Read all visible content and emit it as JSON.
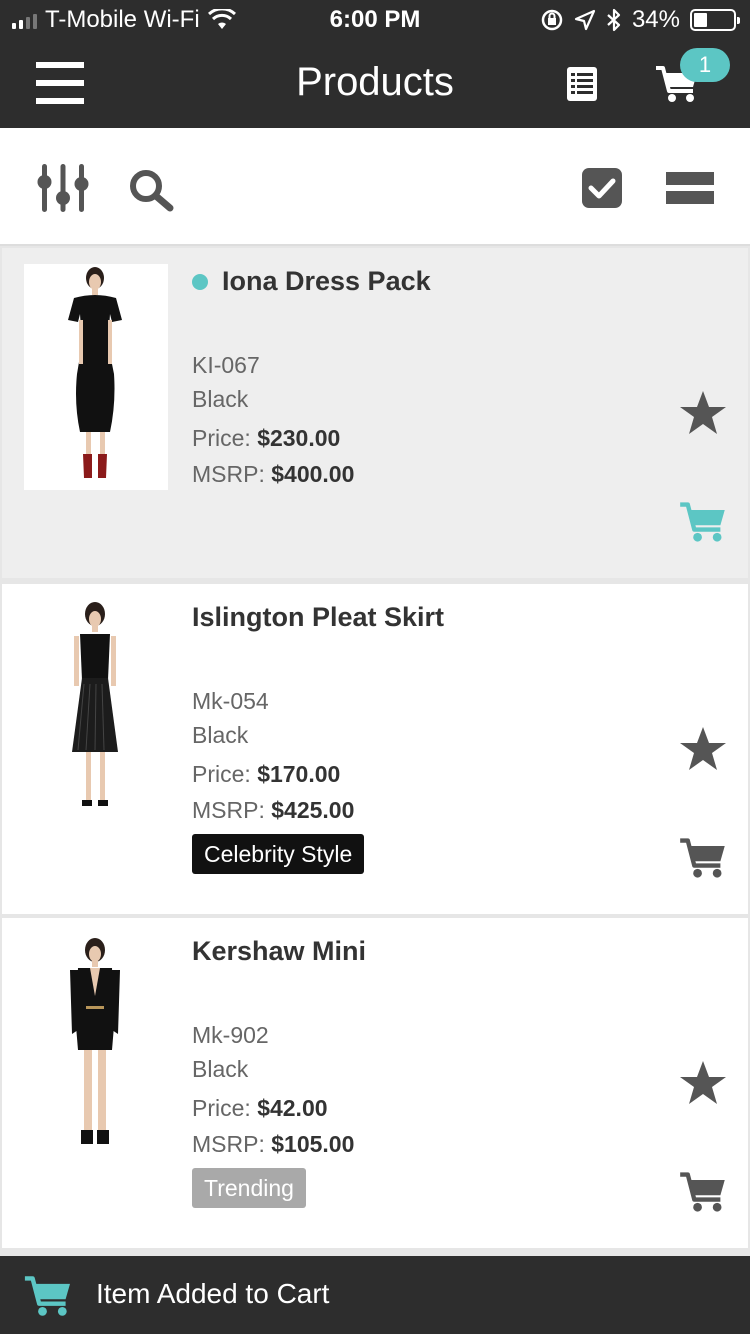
{
  "status_bar": {
    "carrier": "T-Mobile Wi-Fi",
    "time": "6:00 PM",
    "battery": "34%",
    "battery_level": 0.34,
    "icons": [
      "signal-icon",
      "wifi-icon",
      "orientation-lock-icon",
      "location-icon",
      "bluetooth-icon",
      "battery-icon"
    ]
  },
  "header": {
    "title": "Products",
    "cart_count": "1",
    "icons": [
      "menu-icon",
      "list-icon",
      "cart-icon"
    ]
  },
  "toolbar": {
    "icons": [
      "filter-icon",
      "search-icon",
      "checkbox-icon",
      "layout-icon"
    ]
  },
  "products": [
    {
      "name": "Iona Dress Pack",
      "sku": "KI-067",
      "color": "Black",
      "price_label": "Price:",
      "price": "$230.00",
      "msrp_label": "MSRP:",
      "msrp": "$400.00",
      "tag": "",
      "selected": true,
      "in_cart": true
    },
    {
      "name": "Islington Pleat Skirt",
      "sku": "Mk-054",
      "color": "Black",
      "price_label": "Price:",
      "price": "$170.00",
      "msrp_label": "MSRP:",
      "msrp": "$425.00",
      "tag": "Celebrity Style",
      "selected": false,
      "in_cart": false
    },
    {
      "name": "Kershaw Mini",
      "sku": "Mk-902",
      "color": "Black",
      "price_label": "Price:",
      "price": "$42.00",
      "msrp_label": "MSRP:",
      "msrp": "$105.00",
      "tag": "Trending",
      "selected": false,
      "in_cart": false
    }
  ],
  "toast": {
    "message": "Item Added to Cart"
  },
  "colors": {
    "dark_bar": "#2d2d2d",
    "accent": "#5cc6c4",
    "icon_grey": "#555555",
    "tag_dark": "#111111",
    "tag_grey": "#a9a9a9"
  }
}
